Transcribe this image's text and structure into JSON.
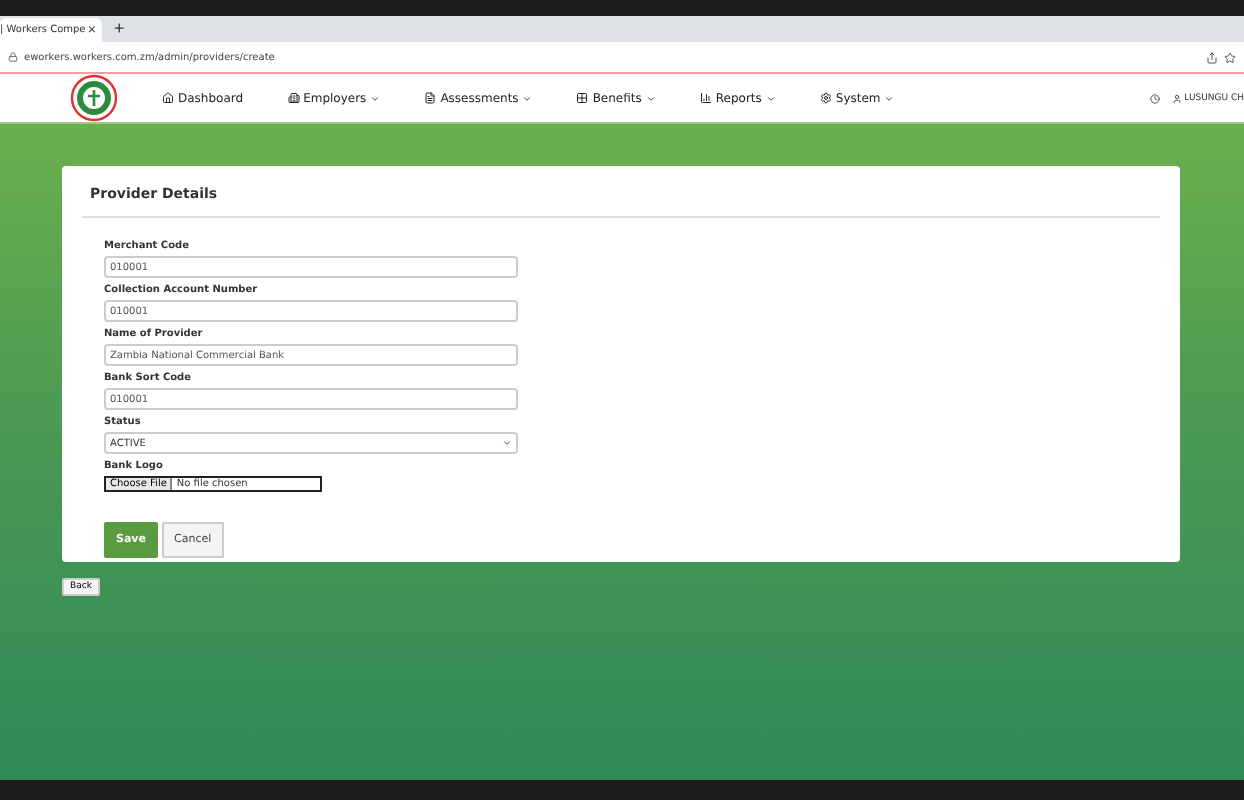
{
  "browser": {
    "tab_title": "| Workers Compe",
    "tab_close": "×",
    "new_tab": "+",
    "url": "eworkers.workers.com.zm/admin/providers/create"
  },
  "nav": {
    "items": [
      {
        "label": "Dashboard",
        "dropdown": false
      },
      {
        "label": "Employers",
        "dropdown": true
      },
      {
        "label": "Assessments",
        "dropdown": true
      },
      {
        "label": "Benefits",
        "dropdown": true
      },
      {
        "label": "Reports",
        "dropdown": true
      },
      {
        "label": "System",
        "dropdown": true
      }
    ],
    "user": "LUSUNGU CH"
  },
  "card": {
    "title": "Provider Details",
    "fields": [
      {
        "kind": "text",
        "label": "Merchant Code",
        "value": "010001"
      },
      {
        "kind": "text",
        "label": "Collection Account Number",
        "value": "010001"
      },
      {
        "kind": "text",
        "label": "Name of Provider",
        "value": "Zambia National Commercial Bank"
      },
      {
        "kind": "text",
        "label": "Bank Sort Code",
        "value": "010001"
      },
      {
        "kind": "select",
        "label": "Status",
        "value": "ACTIVE"
      },
      {
        "kind": "file",
        "label": "Bank Logo",
        "button": "Choose File",
        "value": "No file chosen"
      }
    ],
    "buttons": [
      {
        "label": "Save",
        "kind": "primary"
      },
      {
        "label": "Cancel",
        "kind": "secondary"
      }
    ]
  },
  "back": "Back"
}
